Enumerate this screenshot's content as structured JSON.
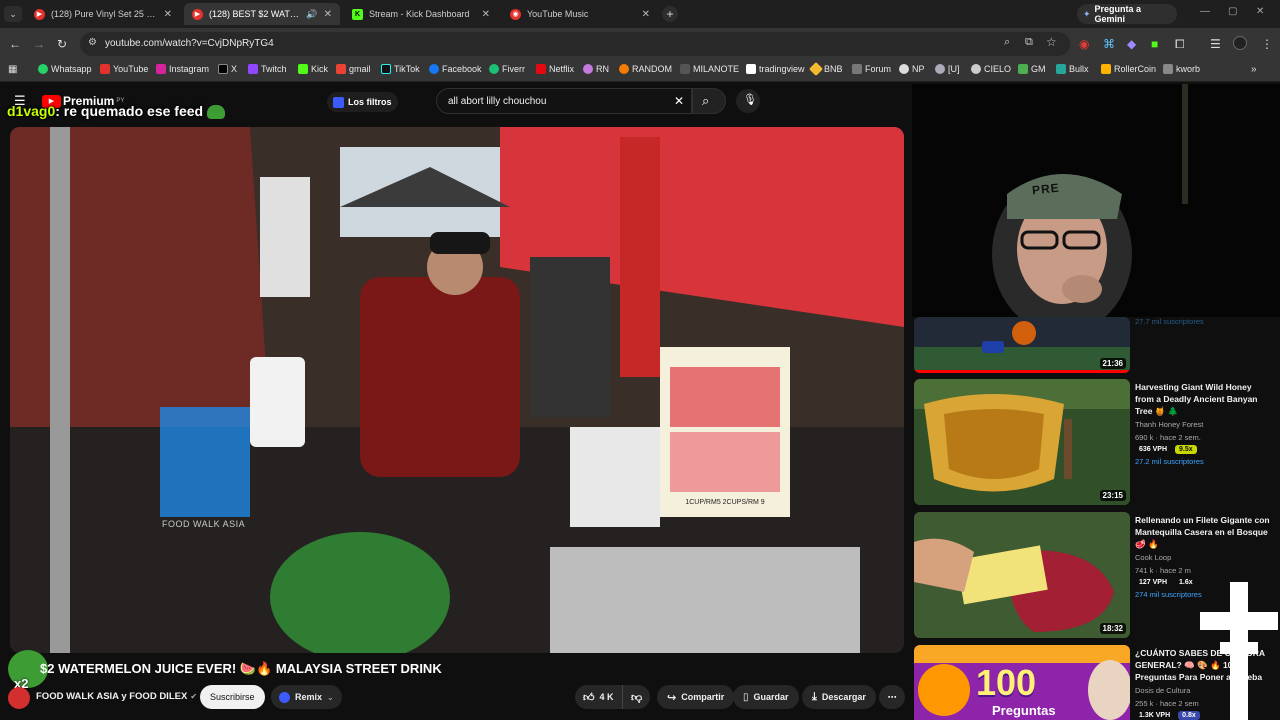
{
  "tabs": [
    {
      "title": "(128) Pure Vinyl Set 25 (Classic",
      "icon": "youtube-icon",
      "color": "#e5322d"
    },
    {
      "title": "(128) BEST $2 WATERMELO",
      "icon": "youtube-icon",
      "color": "#e5322d"
    },
    {
      "title": "Stream - Kick Dashboard",
      "icon": "kick-icon",
      "color": "#53fc18"
    },
    {
      "title": "YouTube Music",
      "icon": "youtube-music-icon",
      "color": "#e5322d"
    }
  ],
  "gemini_label": "Pregunta a Gemini",
  "url": "youtube.com/watch?v=CvjDNpRyTG4",
  "bookmarks": [
    "Whatsapp",
    "YouTube",
    "Instagram",
    "X",
    "Twitch",
    "Kick",
    "gmail",
    "TikTok",
    "Facebook",
    "Fiverr",
    "Netflix",
    "RN",
    "RANDOM",
    "MILANOTE",
    "tradingview",
    "BNB",
    "Forum",
    "NP",
    "[U]",
    "CIELO",
    "GM",
    "Bullx",
    "RollerCoin",
    "kworb"
  ],
  "youtube": {
    "logo_text": "Premium",
    "logo_sup": "PY",
    "filters_label": "Los filtros",
    "search_value": "all abort lilly chouchou"
  },
  "chat_overlay": {
    "user": "d1vag0",
    "message": ": re quemado ese feed"
  },
  "video": {
    "watermark": "FOOD WALK ASIA",
    "sign_text": "1CUP/RM5 2CUPS/RM 9",
    "title": "$2 WATERMELON JUICE EVER! 🍉🔥 MALAYSIA STREET DRINK",
    "channel": "FOOD WALK ASIA y FOOD DILEX",
    "subscribe_label": "Suscribirse",
    "remix_label": "Remix",
    "likes": "4 K",
    "share_label": "Compartir",
    "save_label": "Guardar",
    "download_label": "Descargar",
    "overlay_badge": "x2"
  },
  "recommendations": [
    {
      "duration": "21:36",
      "subs": "27.7 mil suscriptores"
    },
    {
      "title": "Harvesting Giant Wild Honey from a Deadly Ancient Banyan Tree 🍯 🌲",
      "channel": "Thanh Honey Forest",
      "stats": "690 k · hace 2 sem.",
      "vph": "636 VPH",
      "ratio": "9.5x",
      "subs": "27.2 mil suscriptores",
      "duration": "23:15"
    },
    {
      "title": "Rellenando un Filete Gigante con Mantequilla Casera en el Bosque 🥩 🔥",
      "channel": "Cook Loop",
      "stats": "741 k · hace 2 m",
      "vph": "127 VPH",
      "ratio": "1.6x",
      "subs": "274 mil suscriptores",
      "duration": "18:32"
    },
    {
      "title": "¿CUÁNTO SABES DE CULTURA GENERAL? 🧠 🎨 🔥 100 Preguntas Para Poner a Prueba",
      "channel": "Dosis de Cultura",
      "stats": "255 k · hace 2 sem",
      "vph": "1.3K VPH",
      "ratio": "0.8x",
      "thumb_text_1": "100",
      "thumb_text_2": "Preguntas"
    }
  ],
  "webcam_cap_text": "PRE"
}
